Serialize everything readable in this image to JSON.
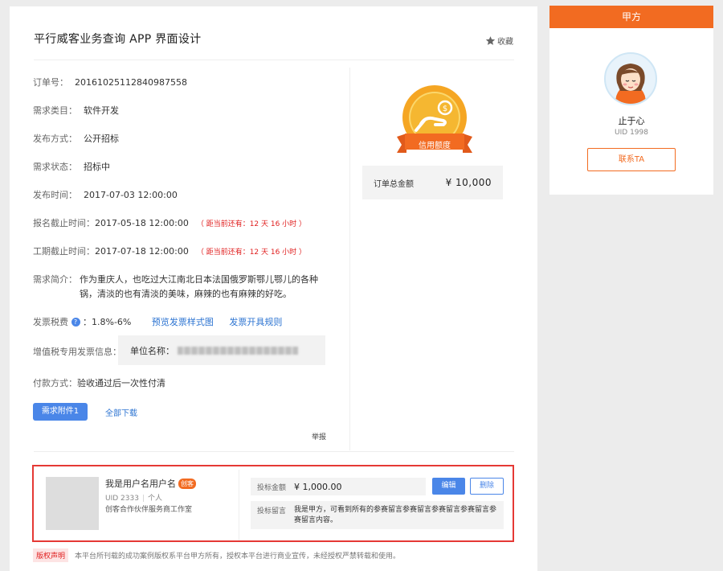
{
  "project": {
    "title": "平行威客业务查询 APP 界面设计",
    "collect_label": "收藏"
  },
  "details": {
    "order_no_label": "订单号：",
    "order_no": "20161025112840987558",
    "category_label": "需求类目：",
    "category": "软件开发",
    "publish_method_label": "发布方式：",
    "publish_method": "公开招标",
    "status_label": "需求状态：",
    "status": "招标中",
    "publish_time_label": "发布时间：",
    "publish_time": "2017-07-03 12:00:00",
    "signup_deadline_label": "报名截止时间：",
    "signup_deadline": "2017-05-18 12:00:00",
    "signup_remaining": "（ 距当前还有：12 天 16 小时 ）",
    "work_deadline_label": "工期截止时间：",
    "work_deadline": "2017-07-18 12:00:00",
    "work_remaining": "（ 距当前还有：12 天 16 小时 ）",
    "intro_label": "需求简介：",
    "intro": "作为重庆人，也吃过大江南北日本法国俄罗斯鄂儿鄂儿的各种锅，清淡的也有清淡的美味，麻辣的也有麻辣的好吃。",
    "tax_label": "发票税费",
    "tax_help": "?",
    "tax_value": "：1.8%-6%",
    "invoice_preview_link": "预览发票样式图",
    "invoice_rules_link": "发票开具规则",
    "vat_label": "增值税专用发票信息：",
    "vat_company_label": "单位名称：",
    "payment_label": "付款方式：",
    "payment": "验收通过后一次性付清",
    "attachment_button": "需求附件1",
    "download_all_link": "全部下载",
    "report_link": "举报"
  },
  "credit": {
    "badge_label": "信用额度",
    "total_label": "订单总金额",
    "total_value": "¥ 10,000"
  },
  "bid": {
    "user_name": "我是用户名用户名",
    "user_tag": "创客",
    "uid": "UID 2333",
    "user_type": "个人",
    "studio": "创客合作伙伴服务商工作室",
    "amount_label": "投标金额",
    "amount": "¥ 1,000.00",
    "edit_button": "编辑",
    "delete_button": "删除",
    "message_label": "投标留言",
    "message": "我是甲方，可看到所有的参赛留言参赛留言参赛留言参赛留言参赛留言内容。"
  },
  "copyright": {
    "tag": "版权声明",
    "text": "本平台所刊载的成功案例版权系平台甲方所有，授权本平台进行商业宣传，未经授权严禁转载和使用。"
  },
  "client": {
    "header": "甲方",
    "name": "止于心",
    "uid": "UID 1998",
    "contact_button": "联系TA"
  },
  "colors": {
    "accent_orange": "#f26b21",
    "primary_blue": "#4a86e8",
    "warning_red": "#e02020",
    "badge_gold": "#f5a623"
  },
  "icons": [
    "star-icon",
    "credit-badge-icon",
    "help-icon",
    "client-avatar"
  ]
}
